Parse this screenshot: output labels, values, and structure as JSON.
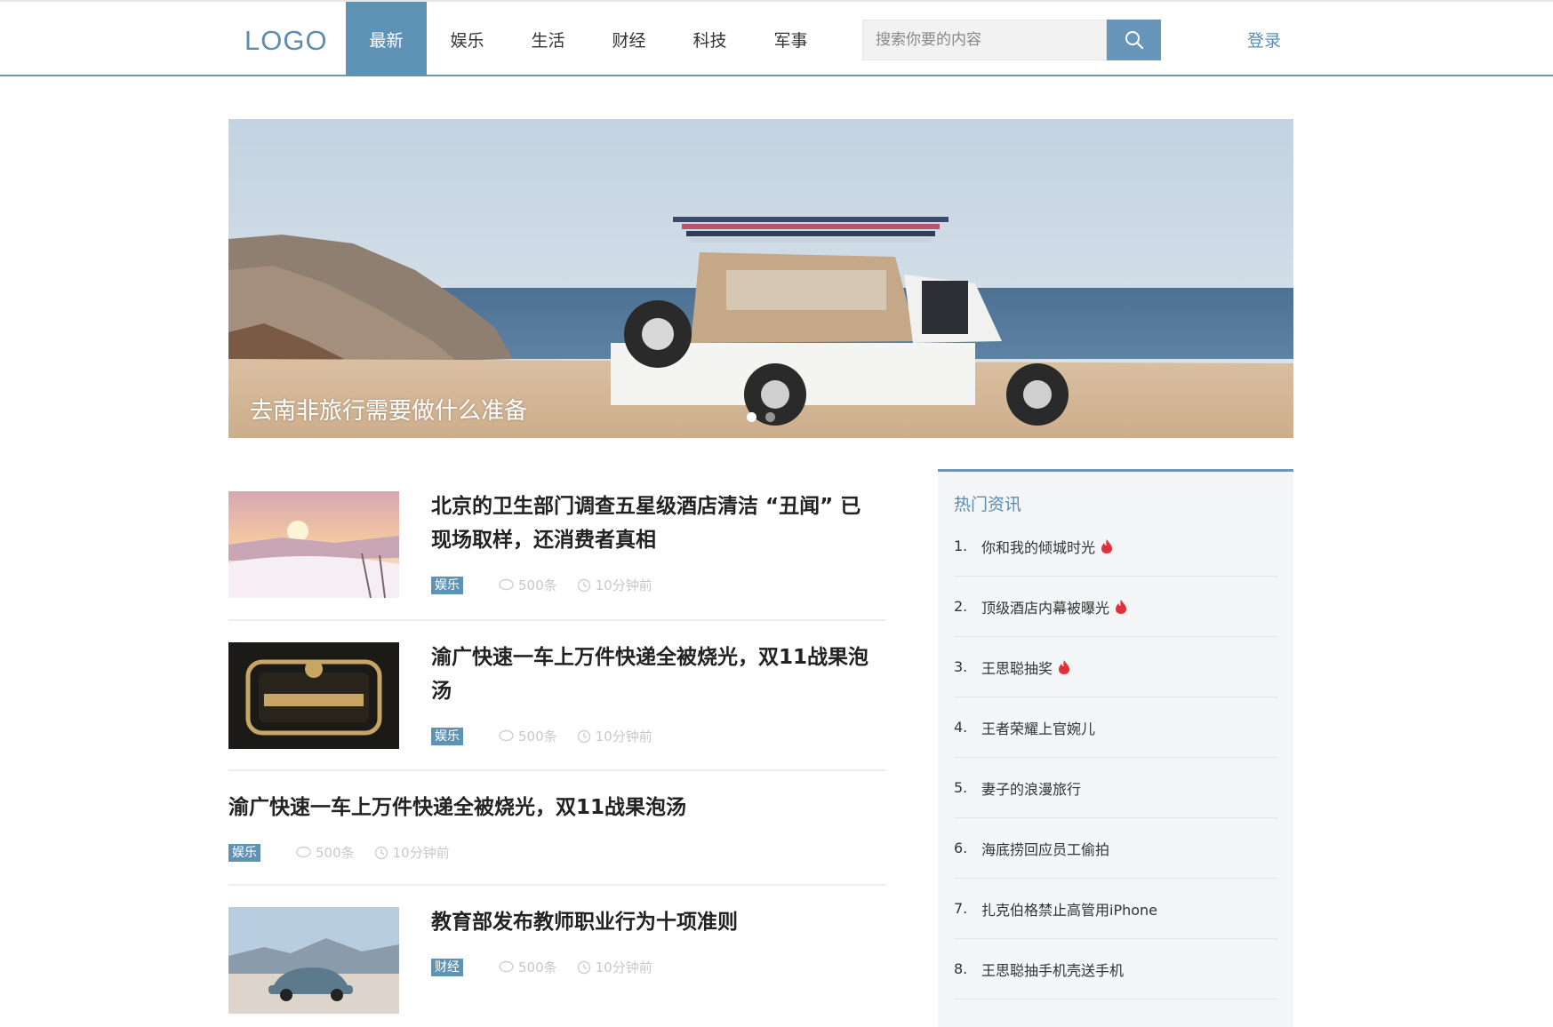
{
  "header": {
    "logo": "LOGO",
    "nav": [
      "最新",
      "娱乐",
      "生活",
      "财经",
      "科技",
      "军事"
    ],
    "search_placeholder": "搜索你要的内容",
    "login": "登录"
  },
  "banner": {
    "caption": "去南非旅行需要做什么准备",
    "slide_count": 2,
    "active_slide": 1
  },
  "news": [
    {
      "title_line1": "北京的卫生部门调查五星级酒店清洁 “丑闻” 已",
      "title_line2": "现场取样，还消费者真相",
      "tag": "娱乐",
      "comments": "500条",
      "time": "10分钟前",
      "thumb": "snow-sunset-image"
    },
    {
      "title_line1": "渝广快速一车上万件快递全被烧光，双11战果泡",
      "title_line2": "汤",
      "tag": "娱乐",
      "comments": "500条",
      "time": "10分钟前",
      "thumb": "gshock-11-11-image"
    },
    {
      "title_line1": "渝广快速一车上万件快递全被烧光，双11战果泡汤",
      "title_line2": "",
      "tag": "娱乐",
      "comments": "500条",
      "time": "10分钟前",
      "thumb": ""
    },
    {
      "title_line1": "教育部发布教师职业行为十项准则",
      "title_line2": "",
      "tag": "财经",
      "comments": "500条",
      "time": "10分钟前",
      "thumb": "beetle-car-image"
    }
  ],
  "sidebar": {
    "title": "热门资讯",
    "items": [
      {
        "num": "1.",
        "text": "你和我的倾城时光",
        "hot": true
      },
      {
        "num": "2.",
        "text": "顶级酒店内幕被曝光",
        "hot": true
      },
      {
        "num": "3.",
        "text": "王思聪抽奖",
        "hot": true
      },
      {
        "num": "4.",
        "text": "王者荣耀上官婉儿",
        "hot": false
      },
      {
        "num": "5.",
        "text": "妻子的浪漫旅行",
        "hot": false
      },
      {
        "num": "6.",
        "text": "海底捞回应员工偷拍",
        "hot": false
      },
      {
        "num": "7.",
        "text": "扎克伯格禁止高管用iPhone",
        "hot": false
      },
      {
        "num": "8.",
        "text": "王思聪抽手机壳送手机",
        "hot": false
      }
    ]
  },
  "colors": {
    "accent": "#5f93b6",
    "fire": "#e0303c"
  }
}
